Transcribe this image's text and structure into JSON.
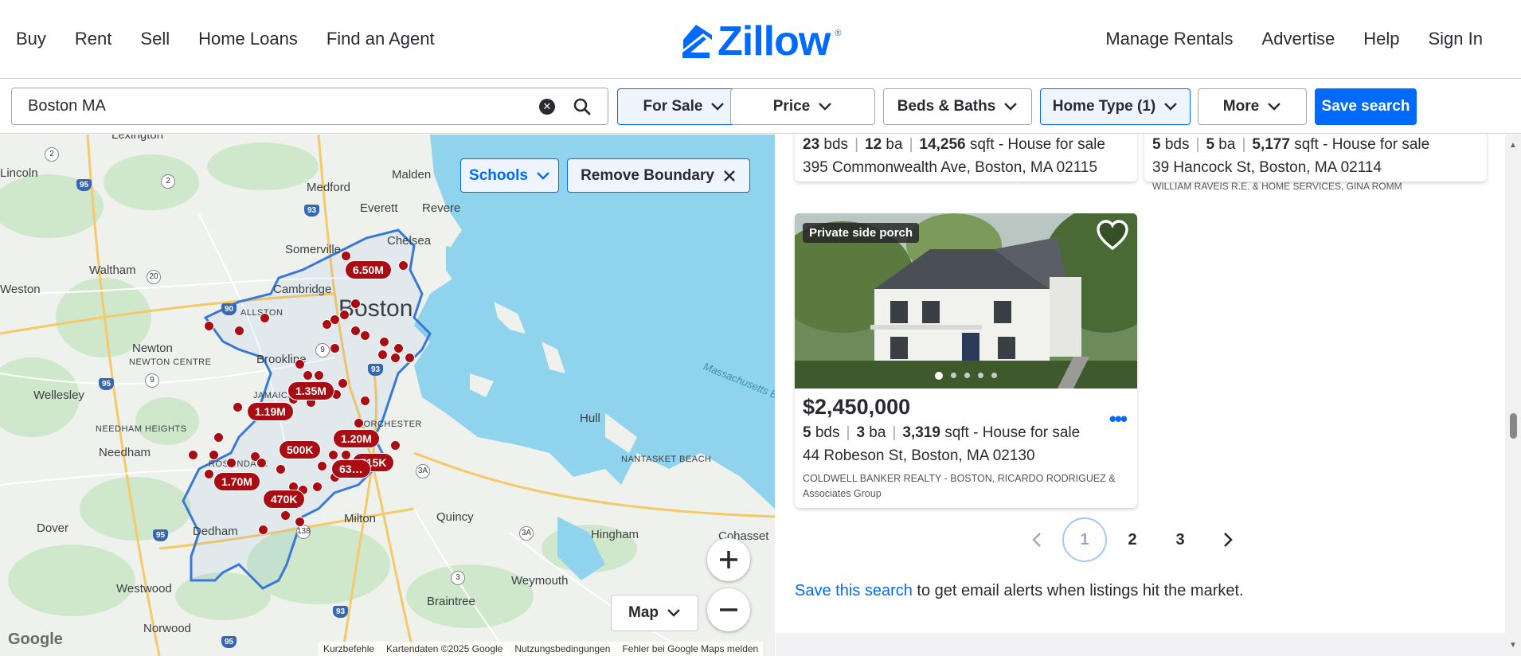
{
  "nav": {
    "left": [
      "Buy",
      "Rent",
      "Sell",
      "Home Loans",
      "Find an Agent"
    ],
    "right": [
      "Manage Rentals",
      "Advertise",
      "Help",
      "Sign In"
    ],
    "logo": "Zillow"
  },
  "search": {
    "value": "Boston MA",
    "filters": {
      "for_sale": "For Sale",
      "price": "Price",
      "beds_baths": "Beds & Baths",
      "home_type": "Home Type (1)",
      "more": "More"
    },
    "save_label": "Save search"
  },
  "map": {
    "schools_label": "Schools",
    "remove_boundary_label": "Remove Boundary",
    "maptype_label": "Map",
    "places": [
      "Lexington",
      "Lincoln",
      "Medford",
      "Malden",
      "Everett",
      "Revere",
      "Somerville",
      "Chelsea",
      "Waltham",
      "Cambridge",
      "Weston",
      "ALLSTON",
      "Boston",
      "Newton",
      "NEWTON CENTRE",
      "Brookline",
      "Wellesley",
      "JAMAICA",
      "DORCHESTER",
      "NEEDHAM HEIGHTS",
      "Needham",
      "ROSLINDALE",
      "Hull",
      "NANTASKET BEACH",
      "Dedham",
      "Quincy",
      "Milton",
      "Dover",
      "Hingham",
      "Cohasset",
      "Westwood",
      "Weymouth",
      "Braintree",
      "Norwood",
      "Massachusetts Bay"
    ],
    "price_pins": [
      "6.50M",
      "1.35M",
      "1.19M",
      "1.20M",
      "500K",
      "715K",
      "63…",
      "1.70M",
      "470K"
    ],
    "attribution": [
      "Kurzbefehle",
      "Kartendaten ©2025 Google",
      "Nutzungsbedingungen",
      "Fehler bei Google Maps melden"
    ],
    "google": "Google"
  },
  "listings": [
    {
      "beds": "23",
      "beds_unit": "bds",
      "baths": "12",
      "baths_unit": "ba",
      "sqft": "14,256",
      "sqft_unit": "sqft",
      "status": "- House for sale",
      "address": "395 Commonwealth Ave, Boston, MA 02115"
    },
    {
      "beds": "5",
      "beds_unit": "bds",
      "baths": "5",
      "baths_unit": "ba",
      "sqft": "5,177",
      "sqft_unit": "sqft",
      "status": "- House for sale",
      "address": "39 Hancock St, Boston, MA 02114",
      "broker": "WILLIAM RAVEIS R.E. & HOME SERVICES, Gina Romm"
    },
    {
      "tag": "Private side porch",
      "price": "$2,450,000",
      "beds": "5",
      "beds_unit": "bds",
      "baths": "3",
      "baths_unit": "ba",
      "sqft": "3,319",
      "sqft_unit": "sqft",
      "status": "- House for sale",
      "address": "44 Robeson St, Boston, MA 02130",
      "broker_line1": "COLDWELL BANKER REALTY - BOSTON, Ricardo Rodriguez &",
      "broker_line2": "Associates Group"
    }
  ],
  "pagination": {
    "pages": [
      "1",
      "2",
      "3"
    ],
    "current": "1"
  },
  "save_prompt": {
    "link": "Save this search",
    "rest": " to get email alerts when listings hit the market."
  },
  "colors": {
    "brand": "#006aff",
    "pin": "#a90d14",
    "water": "#8fd3ec"
  }
}
